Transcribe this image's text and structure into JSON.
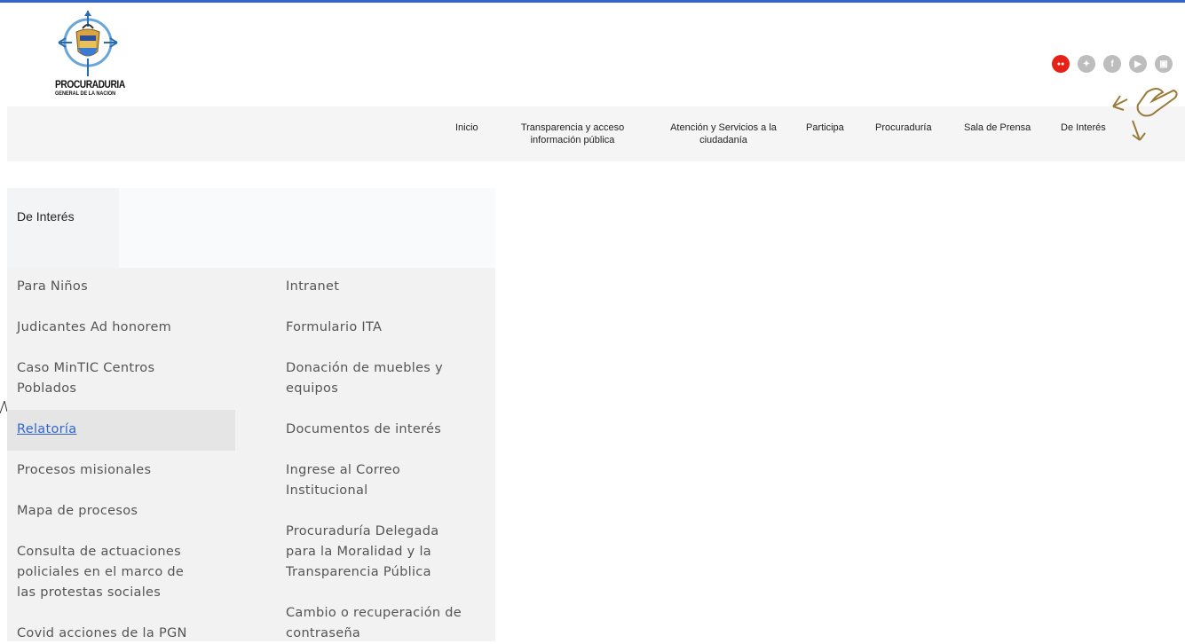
{
  "logo": {
    "line1": "PROCURADURIA",
    "line2": "GENERAL DE LA NACION"
  },
  "social": [
    {
      "icon": "livestream-icon",
      "glyph": "●●",
      "color": "#e62117"
    },
    {
      "icon": "twitter-icon",
      "glyph": "•",
      "color": "#bdbdbd"
    },
    {
      "icon": "facebook-icon",
      "glyph": "f",
      "color": "#bdbdbd"
    },
    {
      "icon": "youtube-icon",
      "glyph": "▶",
      "color": "#bdbdbd"
    },
    {
      "icon": "instagram-icon",
      "glyph": "▣",
      "color": "#bdbdbd"
    }
  ],
  "nav": {
    "items": [
      {
        "line1": "Inicio",
        "line2": ""
      },
      {
        "line1": "Transparencia y acceso",
        "line2": "información pública"
      },
      {
        "line1": "Atención y Servicios a la",
        "line2": "ciudadanía"
      },
      {
        "line1": "Participa",
        "line2": ""
      },
      {
        "line1": "Procuraduría",
        "line2": ""
      },
      {
        "line1": "Sala de Prensa",
        "line2": ""
      },
      {
        "line1": "De Interés",
        "line2": ""
      }
    ]
  },
  "panel": {
    "title": "De Interés",
    "left": [
      "Para Niños",
      "Judicantes Ad honorem",
      "Caso MinTIC Centros\nPoblados",
      "Relatoría",
      "Procesos misionales",
      "Mapa de procesos",
      "Consulta de actuaciones\npoliciales en el marco de\nlas protestas sociales",
      "Covid acciones de la PGN"
    ],
    "right": [
      "Intranet",
      "Formulario ITA",
      "Donación de muebles y\nequipos",
      "Documentos de interés",
      "Ingrese al Correo\nInstitucional",
      "Procuraduría Delegada\npara la Moralidad y la\nTransparencia Pública",
      "Cambio o recuperación de\ncontraseña"
    ],
    "active_index": 3
  },
  "colors": {
    "accent": "#3366cc",
    "live": "#e62117",
    "nav_bg": "#f5f5f5",
    "panel_bg": "#f2f2f2"
  }
}
